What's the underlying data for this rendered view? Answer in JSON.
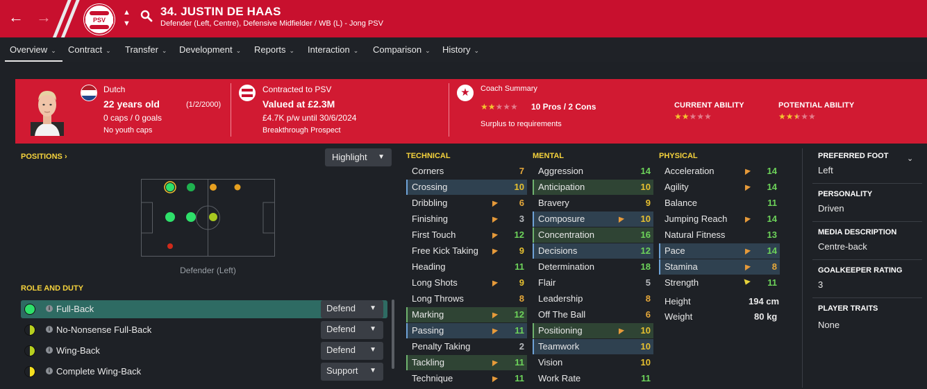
{
  "header": {
    "name": "34. JUSTIN DE HAAS",
    "subtitle": "Defender (Left, Centre), Defensive Midfielder / WB (L) - Jong PSV",
    "badge_text": "PSV",
    "brand_color": "#c8102e"
  },
  "tabs": [
    {
      "label": "Overview"
    },
    {
      "label": "Contract"
    },
    {
      "label": "Transfer"
    },
    {
      "label": "Development"
    },
    {
      "label": "Reports"
    },
    {
      "label": "Interaction"
    },
    {
      "label": "Comparison"
    },
    {
      "label": "History"
    }
  ],
  "summary": {
    "nationality": "Dutch",
    "age": "22 years old",
    "dob": "(1/2/2000)",
    "caps": "0 caps / 0 goals",
    "youth": "No youth caps",
    "contract_club": "Contracted to PSV",
    "value": "Valued at £2.3M",
    "wage": "£4.7K p/w until 30/6/2024",
    "prospect": "Breakthrough Prospect",
    "coach_title": "Coach Summary",
    "coach_stars": 2,
    "pros_cons": "10 Pros / 2 Cons",
    "coach_note": "Surplus to requirements",
    "current_ability_label": "CURRENT ABILITY",
    "current_ability_stars": 2,
    "potential_ability_label": "POTENTIAL ABILITY",
    "potential_ability_stars": 2.5
  },
  "positions": {
    "title": "POSITIONS",
    "highlight_label": "Highlight",
    "caption": "Defender (Left)"
  },
  "roles": {
    "title": "ROLE AND DUTY",
    "items": [
      {
        "name": "Full-Back",
        "duty": "Defend"
      },
      {
        "name": "No-Nonsense Full-Back",
        "duty": "Defend"
      },
      {
        "name": "Wing-Back",
        "duty": "Defend"
      },
      {
        "name": "Complete Wing-Back",
        "duty": "Support"
      }
    ]
  },
  "technical": {
    "title": "TECHNICAL",
    "attrs": [
      {
        "name": "Corners",
        "value": "7"
      },
      {
        "name": "Crossing",
        "value": "10"
      },
      {
        "name": "Dribbling",
        "value": "6"
      },
      {
        "name": "Finishing",
        "value": "3"
      },
      {
        "name": "First Touch",
        "value": "12"
      },
      {
        "name": "Free Kick Taking",
        "value": "9"
      },
      {
        "name": "Heading",
        "value": "11"
      },
      {
        "name": "Long Shots",
        "value": "9"
      },
      {
        "name": "Long Throws",
        "value": "8"
      },
      {
        "name": "Marking",
        "value": "12"
      },
      {
        "name": "Passing",
        "value": "11"
      },
      {
        "name": "Penalty Taking",
        "value": "2"
      },
      {
        "name": "Tackling",
        "value": "11"
      },
      {
        "name": "Technique",
        "value": "11"
      }
    ]
  },
  "mental": {
    "title": "MENTAL",
    "attrs": [
      {
        "name": "Aggression",
        "value": "14"
      },
      {
        "name": "Anticipation",
        "value": "10"
      },
      {
        "name": "Bravery",
        "value": "9"
      },
      {
        "name": "Composure",
        "value": "10"
      },
      {
        "name": "Concentration",
        "value": "16"
      },
      {
        "name": "Decisions",
        "value": "12"
      },
      {
        "name": "Determination",
        "value": "18"
      },
      {
        "name": "Flair",
        "value": "5"
      },
      {
        "name": "Leadership",
        "value": "8"
      },
      {
        "name": "Off The Ball",
        "value": "6"
      },
      {
        "name": "Positioning",
        "value": "10"
      },
      {
        "name": "Teamwork",
        "value": "10"
      },
      {
        "name": "Vision",
        "value": "10"
      },
      {
        "name": "Work Rate",
        "value": "11"
      }
    ]
  },
  "physical": {
    "title": "PHYSICAL",
    "attrs": [
      {
        "name": "Acceleration",
        "value": "14"
      },
      {
        "name": "Agility",
        "value": "14"
      },
      {
        "name": "Balance",
        "value": "11"
      },
      {
        "name": "Jumping Reach",
        "value": "14"
      },
      {
        "name": "Natural Fitness",
        "value": "13"
      },
      {
        "name": "Pace",
        "value": "14"
      },
      {
        "name": "Stamina",
        "value": "8"
      },
      {
        "name": "Strength",
        "value": "11"
      }
    ],
    "height_label": "Height",
    "height": "194 cm",
    "weight_label": "Weight",
    "weight": "80 kg"
  },
  "info": {
    "foot_label": "PREFERRED FOOT",
    "foot": "Left",
    "personality_label": "PERSONALITY",
    "personality": "Driven",
    "media_label": "MEDIA DESCRIPTION",
    "media": "Centre-back",
    "gk_label": "GOALKEEPER RATING",
    "gk": "3",
    "traits_label": "PLAYER TRAITS",
    "traits": "None"
  }
}
